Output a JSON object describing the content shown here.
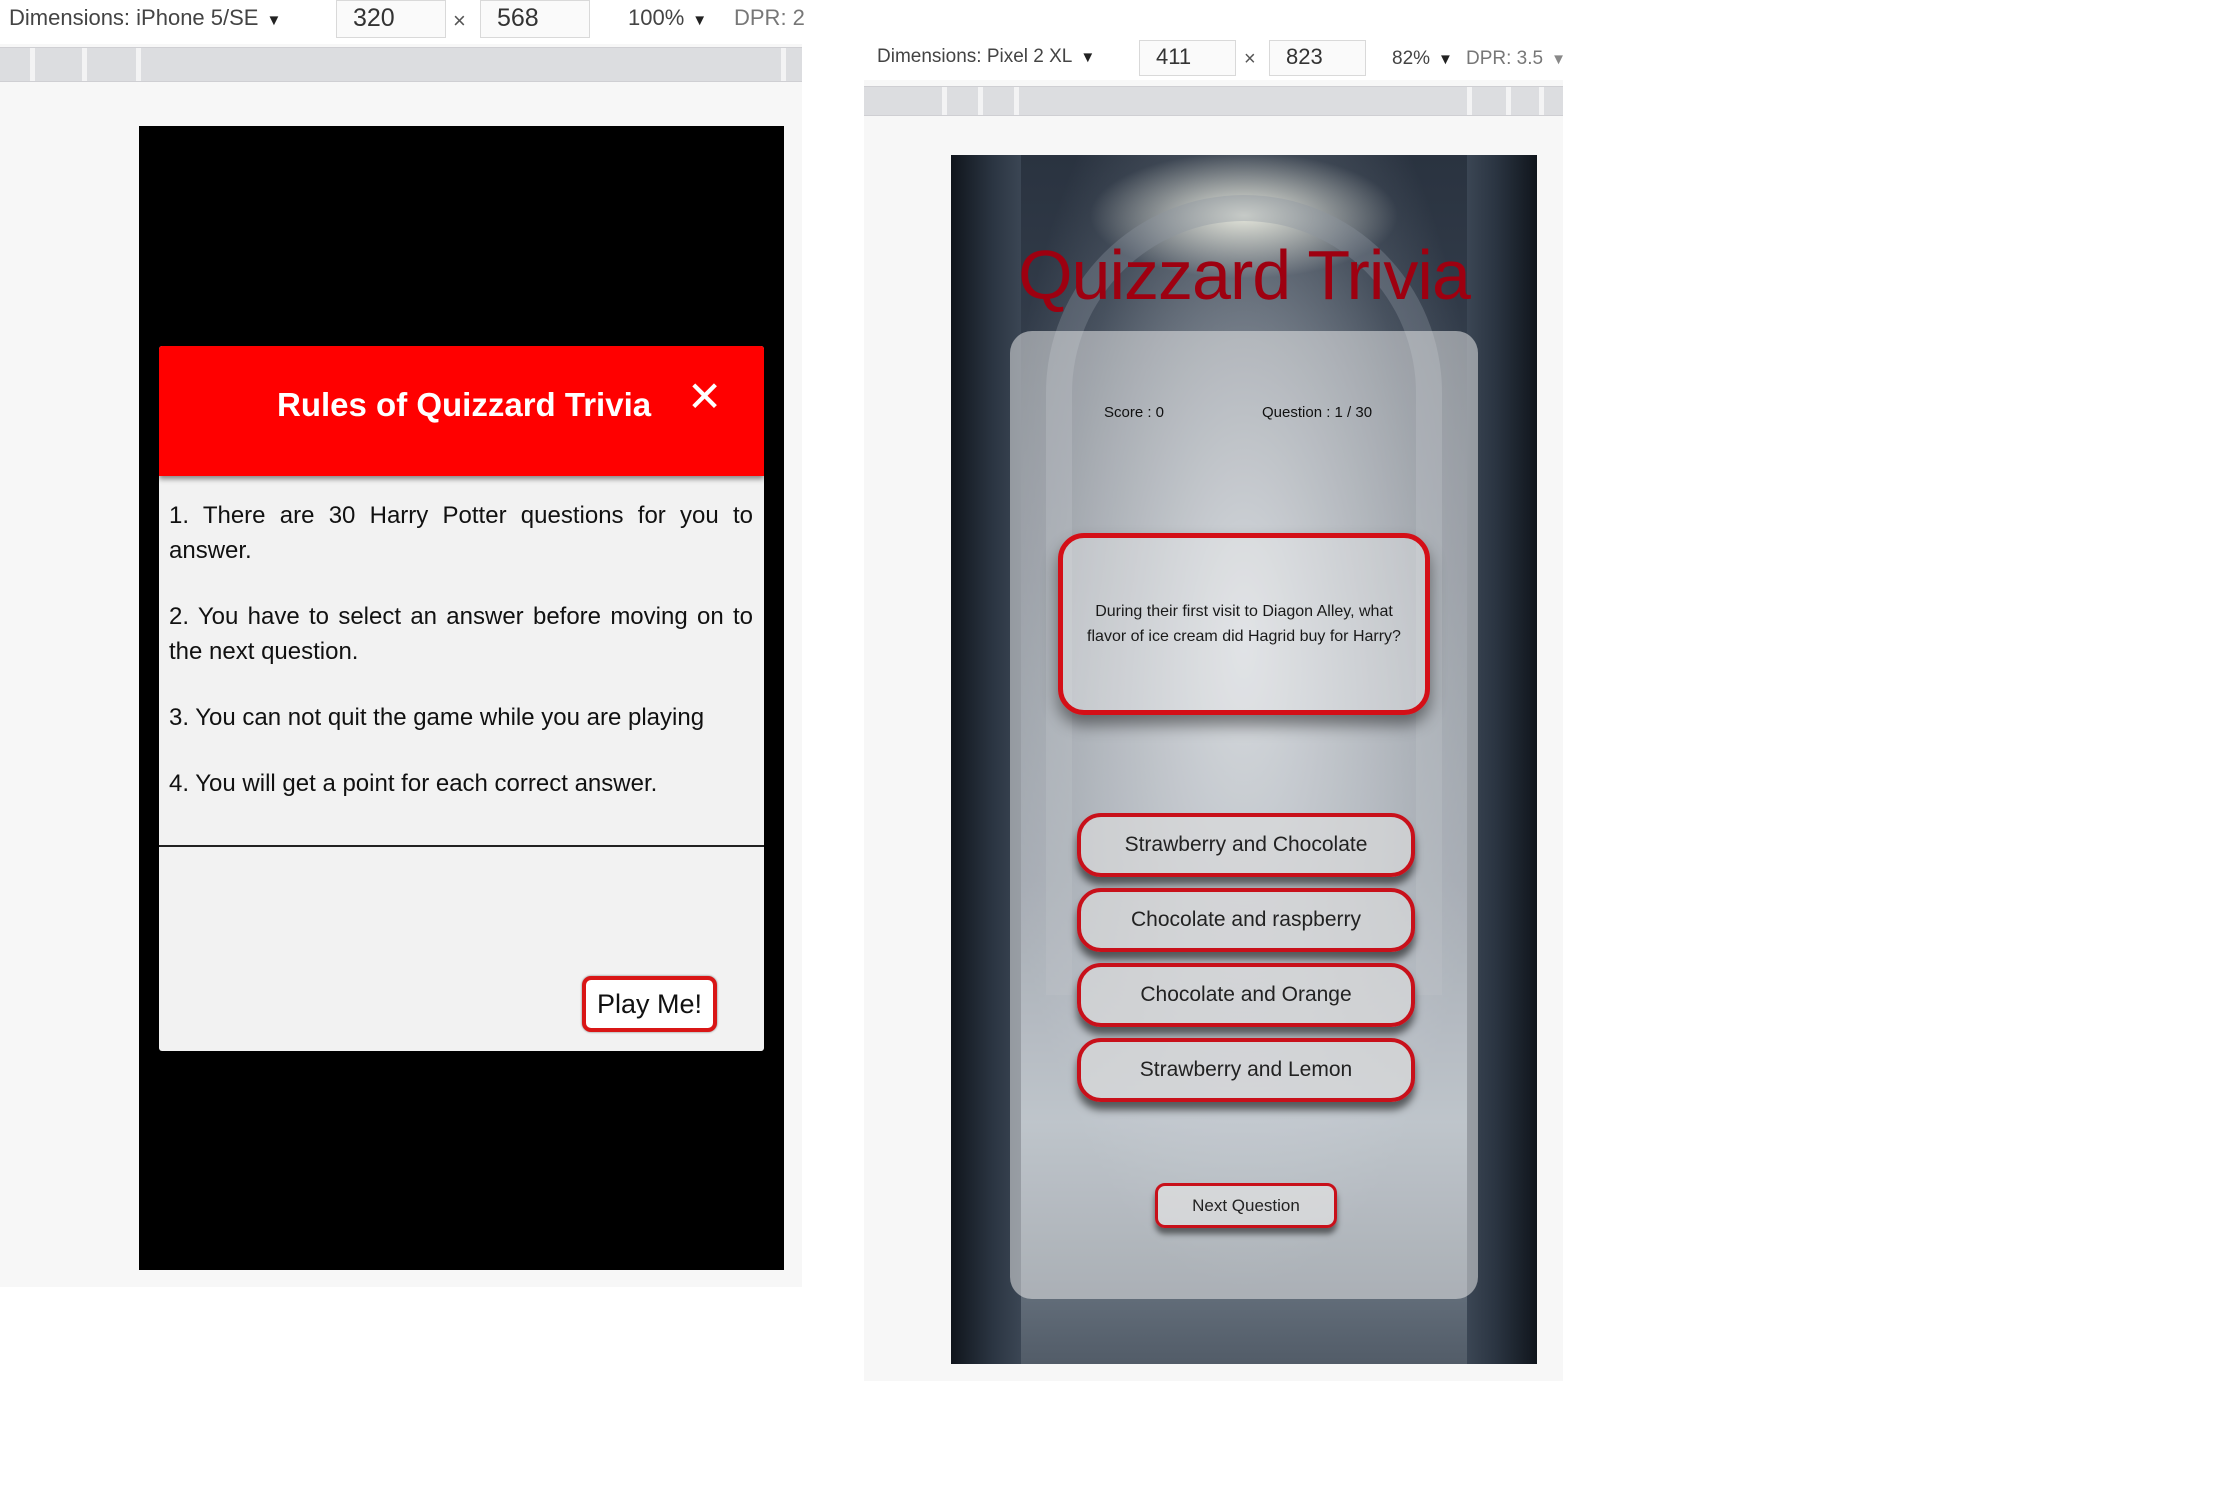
{
  "left_devtools": {
    "device_label": "Dimensions: iPhone 5/SE",
    "width": "320",
    "height": "568",
    "times": "×",
    "zoom": "100%",
    "dpr": "DPR: 2"
  },
  "right_devtools": {
    "device_label": "Dimensions: Pixel 2 XL",
    "width": "411",
    "height": "823",
    "times": "×",
    "zoom": "82%",
    "dpr": "DPR: 3.5"
  },
  "rules_modal": {
    "title": "Rules of Quizzard Trivia",
    "close": "✕",
    "rules": [
      "1. There are 30 Harry Potter questions for you to answer.",
      "2. You have to select an answer before moving on to the next question.",
      "3. You can not quit the game while you are playing",
      "4. You will get a point for each correct answer."
    ],
    "play_label": "Play Me!"
  },
  "quiz": {
    "title": "Quizzard Trivia",
    "score": "Score : 0",
    "question_count": "Question : 1 / 30",
    "question": "During their first visit to Diagon Alley, what flavor of ice cream did Hagrid buy for Harry?",
    "answers": [
      "Strawberry and Chocolate",
      "Chocolate and raspberry",
      "Chocolate and Orange",
      "Strawberry and Lemon"
    ],
    "next_label": "Next Question"
  },
  "colors": {
    "modal_header": "#ff0000",
    "title_red": "#9e0010",
    "border_red": "#d40f17"
  },
  "icons": {
    "dropdown": "triangle-down-icon",
    "close": "close-icon"
  }
}
